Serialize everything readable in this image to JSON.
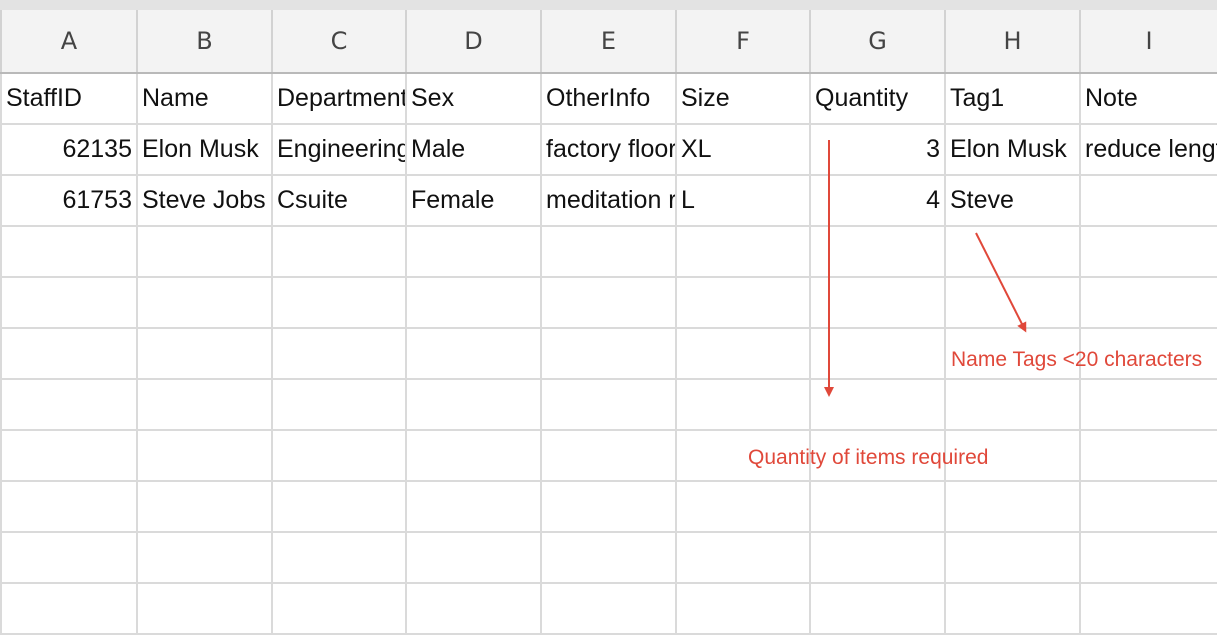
{
  "sheet": {
    "columns": [
      "A",
      "B",
      "C",
      "D",
      "E",
      "F",
      "G",
      "H",
      "I"
    ],
    "rows": [
      [
        "StaffID",
        "Name",
        "Department",
        "Sex",
        "OtherInfo",
        "Size",
        "Quantity",
        "Tag1",
        "Note"
      ],
      [
        "62135",
        "Elon Musk",
        "Engineering",
        "Male",
        "factory floor",
        "XL",
        "3",
        "Elon Musk",
        "reduce length"
      ],
      [
        "61753",
        "Steve Jobs",
        "Csuite",
        "Female",
        "meditation r",
        "L",
        "4",
        "Steve",
        ""
      ],
      [
        "",
        "",
        "",
        "",
        "",
        "",
        "",
        "",
        ""
      ],
      [
        "",
        "",
        "",
        "",
        "",
        "",
        "",
        "",
        ""
      ],
      [
        "",
        "",
        "",
        "",
        "",
        "",
        "",
        "",
        ""
      ],
      [
        "",
        "",
        "",
        "",
        "",
        "",
        "",
        "",
        ""
      ],
      [
        "",
        "",
        "",
        "",
        "",
        "",
        "",
        "",
        ""
      ],
      [
        "",
        "",
        "",
        "",
        "",
        "",
        "",
        "",
        ""
      ],
      [
        "",
        "",
        "",
        "",
        "",
        "",
        "",
        "",
        ""
      ],
      [
        "",
        "",
        "",
        "",
        "",
        "",
        "",
        "",
        ""
      ]
    ],
    "numeric_cells": [
      [
        1,
        0
      ],
      [
        1,
        6
      ],
      [
        2,
        0
      ],
      [
        2,
        6
      ]
    ]
  },
  "annotations": {
    "color": "#e0483a",
    "name_tags": "Name Tags <20 characters",
    "quantity": "Quantity of items required"
  }
}
